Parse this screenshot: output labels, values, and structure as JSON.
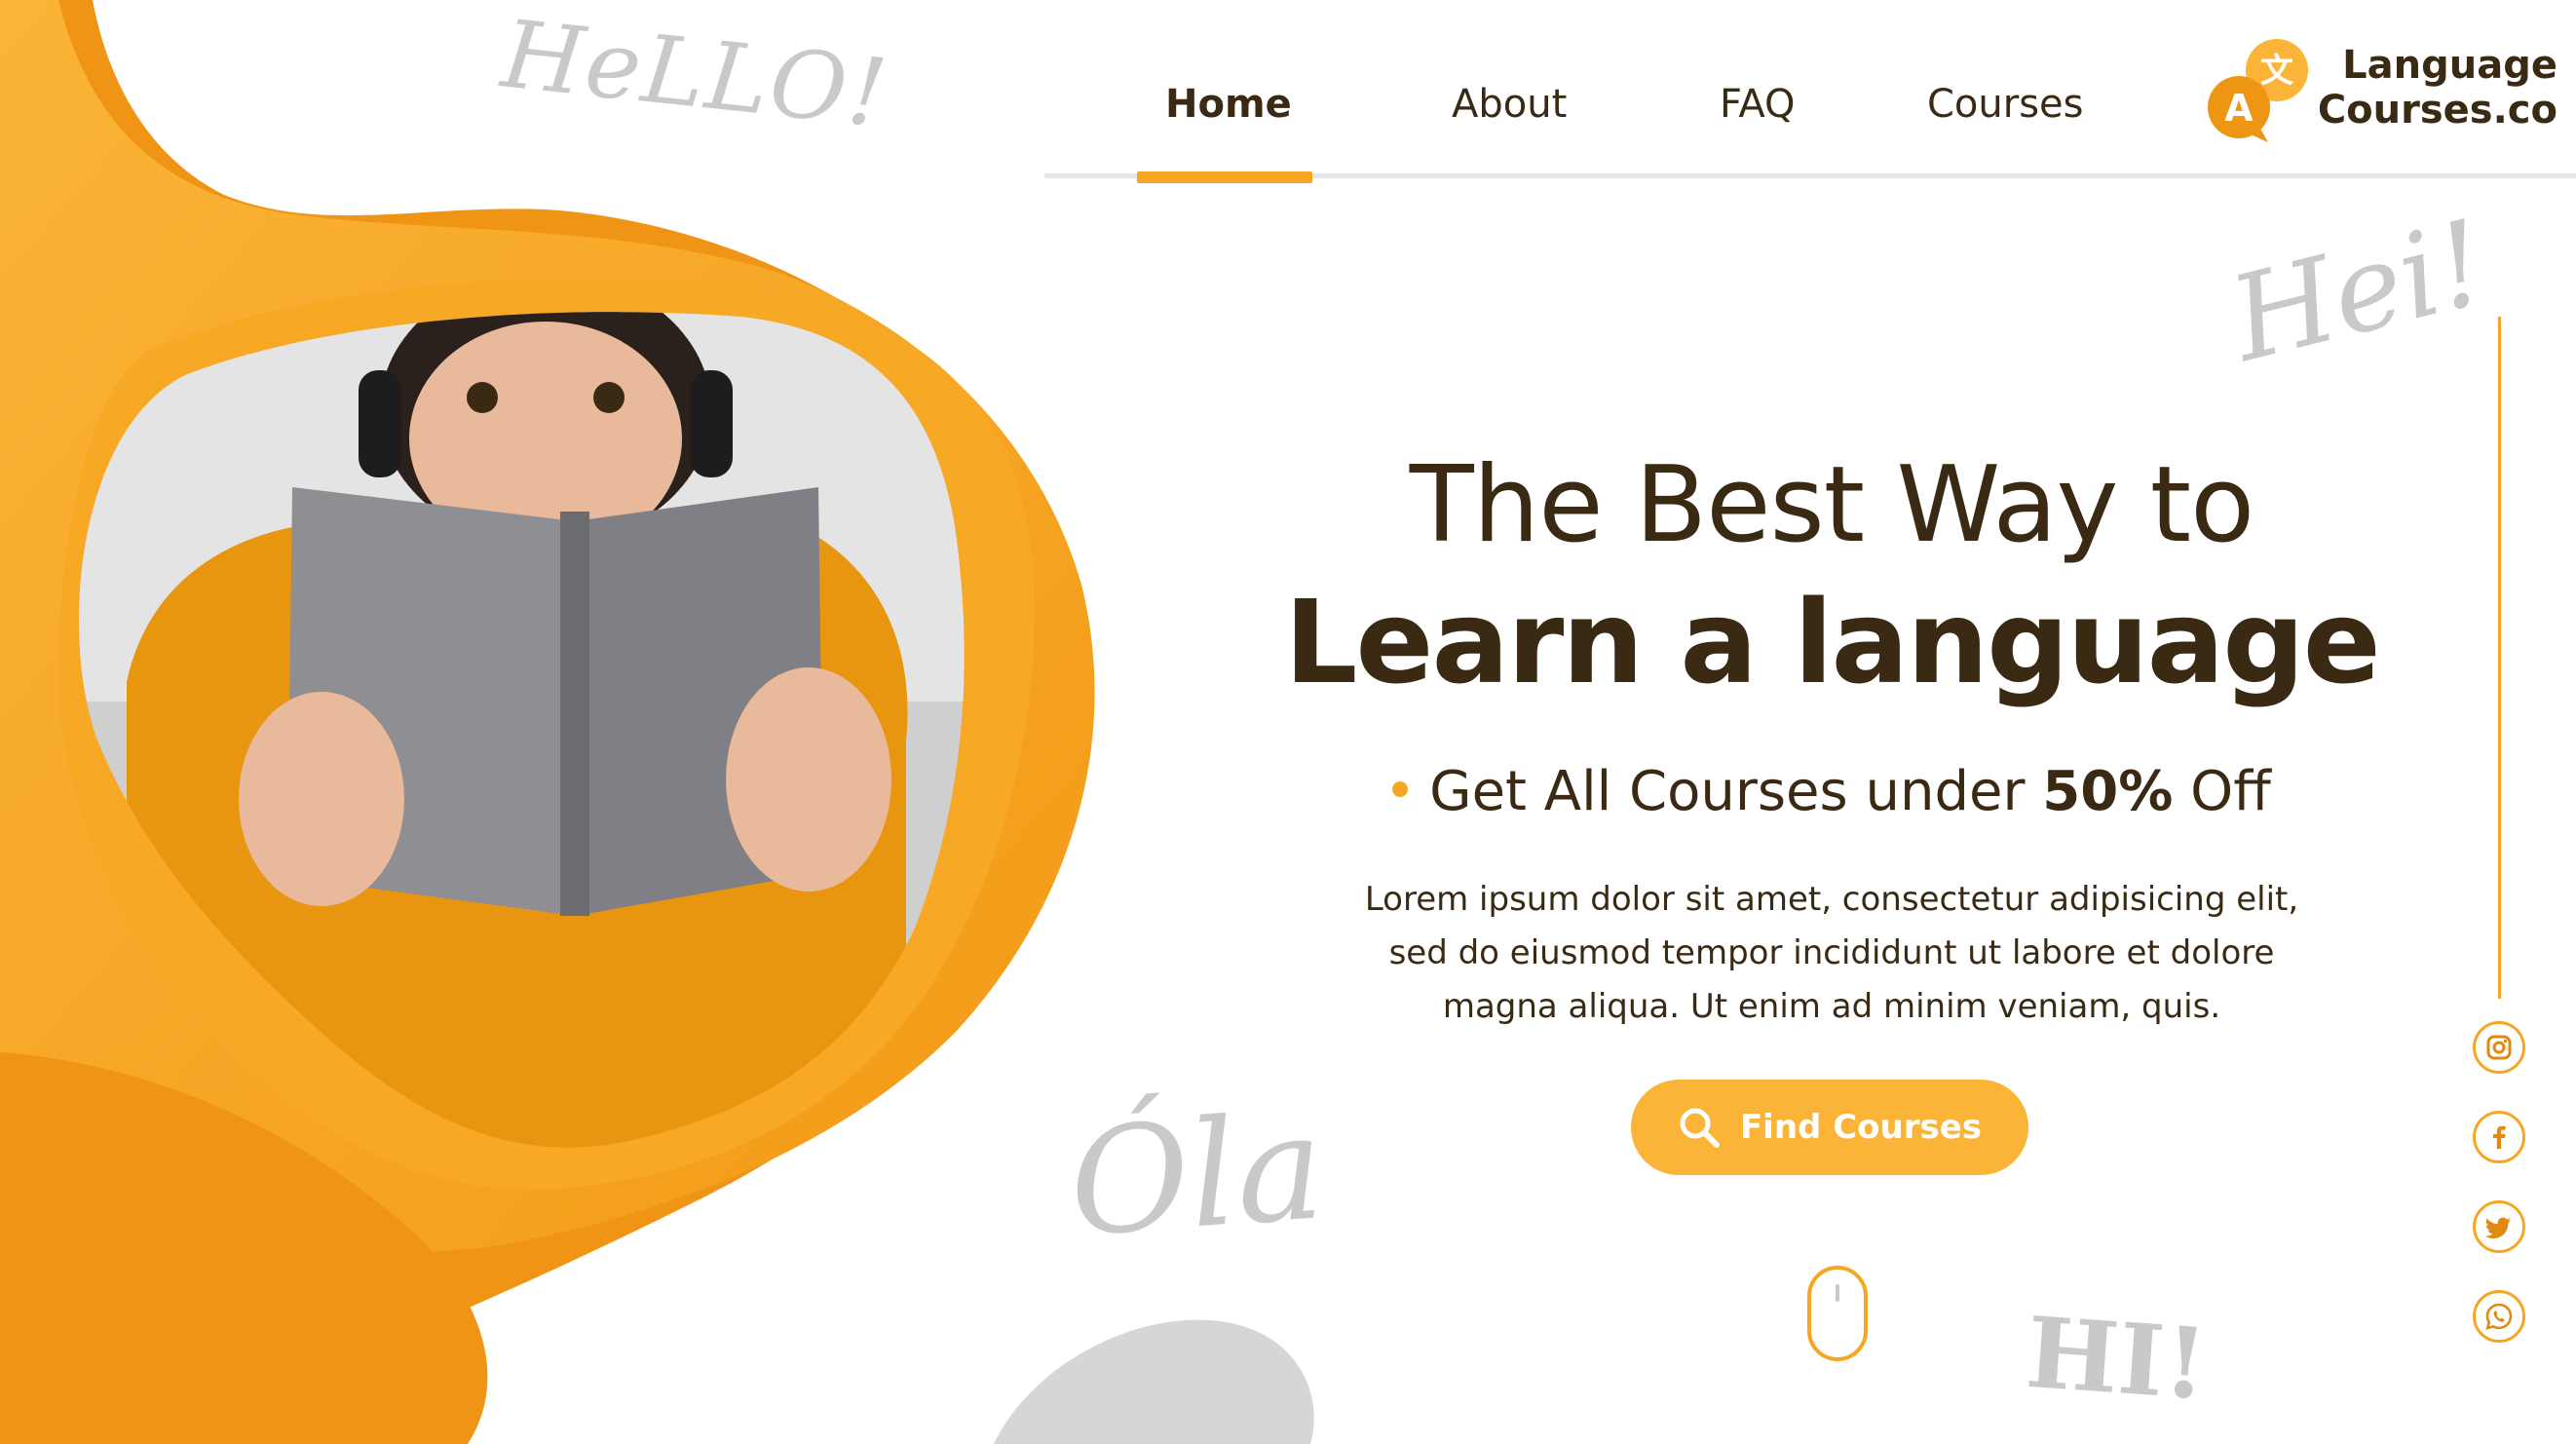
{
  "colors": {
    "accent": "#f6a623",
    "accent_light": "#fbb437",
    "accent_dark": "#ee9513",
    "text": "#3a2a14",
    "greeting": "#c9c9c9"
  },
  "greetings": {
    "hello": "HeLLO!",
    "hei": "Hei!",
    "ola": "Óla",
    "hi": "HI!"
  },
  "nav": {
    "items": [
      {
        "label": "Home",
        "active": true
      },
      {
        "label": "About"
      },
      {
        "label": "FAQ"
      },
      {
        "label": "Courses"
      }
    ]
  },
  "logo": {
    "line1": "Language",
    "line2": "Courses.co",
    "icon": "translate-speech-bubbles-icon"
  },
  "hero": {
    "line1": "The Best Way to",
    "line2": "Learn a language",
    "promo_prefix": "Get All Courses under ",
    "promo_bold": "50%",
    "promo_suffix": " Off",
    "body": "Lorem ipsum dolor sit amet, consectetur adipisicing elit, sed do eiusmod tempor incididunt ut labore et dolore magna aliqua. Ut enim ad minim veniam, quis.",
    "cta_label": "Find Courses",
    "cta_icon": "search-icon"
  },
  "photo": {
    "subject": "woman-reading-book-with-headphones",
    "icon": "photo"
  },
  "social": [
    "instagram-icon",
    "facebook-icon",
    "twitter-icon",
    "whatsapp-icon"
  ],
  "scroll_indicator": "mouse-icon"
}
